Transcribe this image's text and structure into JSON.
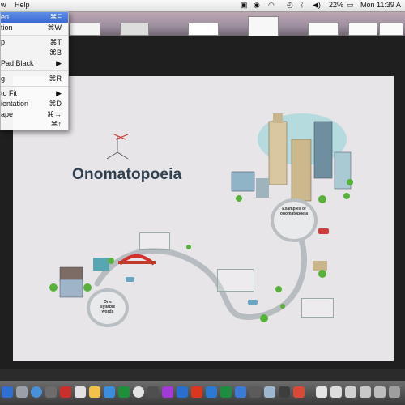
{
  "menubar": {
    "menus": [
      "w",
      "Help"
    ],
    "battery_percent": "22%",
    "clock": "Mon 11:39 A"
  },
  "view_menu": {
    "items": [
      {
        "label": "en",
        "shortcut": "⌘F",
        "selected": true
      },
      {
        "label": "tion",
        "shortcut": "⌘W"
      },
      {
        "label": "p",
        "shortcut": "⌘T"
      },
      {
        "label": "",
        "shortcut": "⌘B"
      },
      {
        "label": "Pad Black",
        "shortcut": "▶"
      },
      {
        "label": "g",
        "shortcut": "⌘R"
      },
      {
        "label": "to Fit",
        "shortcut": "▶"
      },
      {
        "label": "ientation",
        "shortcut": "⌘D"
      },
      {
        "label": "ape",
        "shortcut": "⌘→"
      },
      {
        "label": "",
        "shortcut": "⌘↑"
      }
    ]
  },
  "presentation": {
    "title": "Onomatopoeia",
    "bubble_left": "One\nsyllable\nwords",
    "bubble_right": "Examples of onomatopoeia"
  },
  "colors": {
    "menu_highlight": "#3b69d4",
    "path": "#b6bcc0",
    "title": "#2f4050",
    "bridge": "#d0312d"
  }
}
